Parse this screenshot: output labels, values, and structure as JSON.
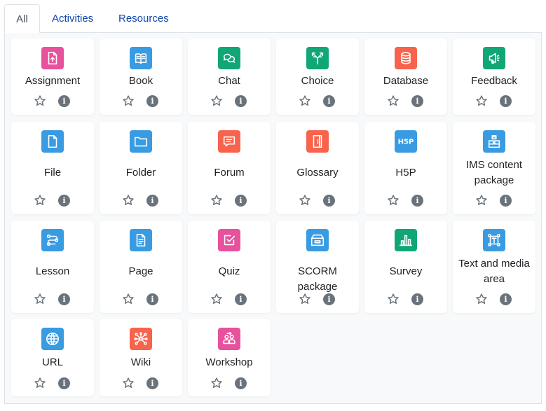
{
  "tabs": [
    {
      "label": "All",
      "active": true
    },
    {
      "label": "Activities",
      "active": false
    },
    {
      "label": "Resources",
      "active": false
    }
  ],
  "modules": [
    {
      "name": "Assignment",
      "icon": "assignment-icon",
      "color": "#e8519c"
    },
    {
      "name": "Book",
      "icon": "book-icon",
      "color": "#399be2"
    },
    {
      "name": "Chat",
      "icon": "chat-icon",
      "color": "#11a676"
    },
    {
      "name": "Choice",
      "icon": "choice-icon",
      "color": "#11a676"
    },
    {
      "name": "Database",
      "icon": "database-icon",
      "color": "#f7634d"
    },
    {
      "name": "Feedback",
      "icon": "feedback-icon",
      "color": "#11a676"
    },
    {
      "name": "File",
      "icon": "file-icon",
      "color": "#399be2"
    },
    {
      "name": "Folder",
      "icon": "folder-icon",
      "color": "#399be2"
    },
    {
      "name": "Forum",
      "icon": "forum-icon",
      "color": "#f7634d"
    },
    {
      "name": "Glossary",
      "icon": "glossary-icon",
      "color": "#f7634d"
    },
    {
      "name": "H5P",
      "icon": "h5p-icon",
      "color": "#399be2"
    },
    {
      "name": "IMS content package",
      "icon": "ims-package-icon",
      "color": "#399be2"
    },
    {
      "name": "Lesson",
      "icon": "lesson-icon",
      "color": "#399be2"
    },
    {
      "name": "Page",
      "icon": "page-icon",
      "color": "#399be2"
    },
    {
      "name": "Quiz",
      "icon": "quiz-icon",
      "color": "#e8519c"
    },
    {
      "name": "SCORM package",
      "icon": "scorm-icon",
      "color": "#399be2"
    },
    {
      "name": "Survey",
      "icon": "survey-icon",
      "color": "#11a676"
    },
    {
      "name": "Text and media area",
      "icon": "text-media-icon",
      "color": "#399be2"
    },
    {
      "name": "URL",
      "icon": "url-icon",
      "color": "#399be2"
    },
    {
      "name": "Wiki",
      "icon": "wiki-icon",
      "color": "#f7634d"
    },
    {
      "name": "Workshop",
      "icon": "workshop-icon",
      "color": "#e8519c"
    }
  ],
  "card_actions": {
    "star_icon": "star-outline-icon",
    "info_icon": "info-circle-icon",
    "info_glyph": "i"
  }
}
